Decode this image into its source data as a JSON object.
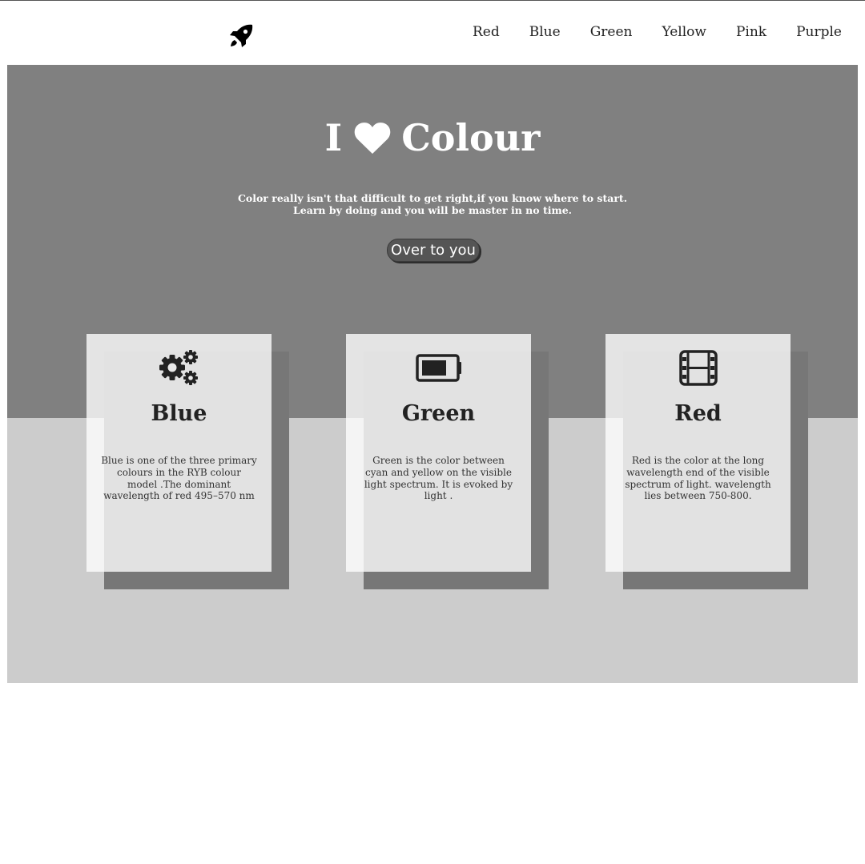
{
  "nav": {
    "logo_icon": "rocket-icon",
    "links": [
      "Red",
      "Blue",
      "Green",
      "Yellow",
      "Pink",
      "Purple"
    ]
  },
  "hero": {
    "title_before": "I",
    "title_icon": "heart-icon",
    "title_after": "Colour",
    "subtitle_line1": "Color really isn't that difficult to get right,if you know where to start.",
    "subtitle_line2": "Learn by doing and you will be master in no time.",
    "cta_label": "Over to you"
  },
  "cards": [
    {
      "icon": "gears-icon",
      "title": "Blue",
      "text": "Blue is one of the three primary colours in the RYB colour model .The dominant wavelength of red 495–570 nm"
    },
    {
      "icon": "battery-icon",
      "title": "Green",
      "text": "Green is the color between cyan and yellow on the visible light spectrum. It is evoked by light ."
    },
    {
      "icon": "film-icon",
      "title": "Red",
      "text": "Red is the color at the long wavelength end of the visible spectrum of light. wavelength lies between 750-800."
    }
  ],
  "colors": {
    "hero_bg": "#808080",
    "lower_bg": "#cccccc",
    "card_shadow": "#777777",
    "button_bg": "#555555"
  }
}
